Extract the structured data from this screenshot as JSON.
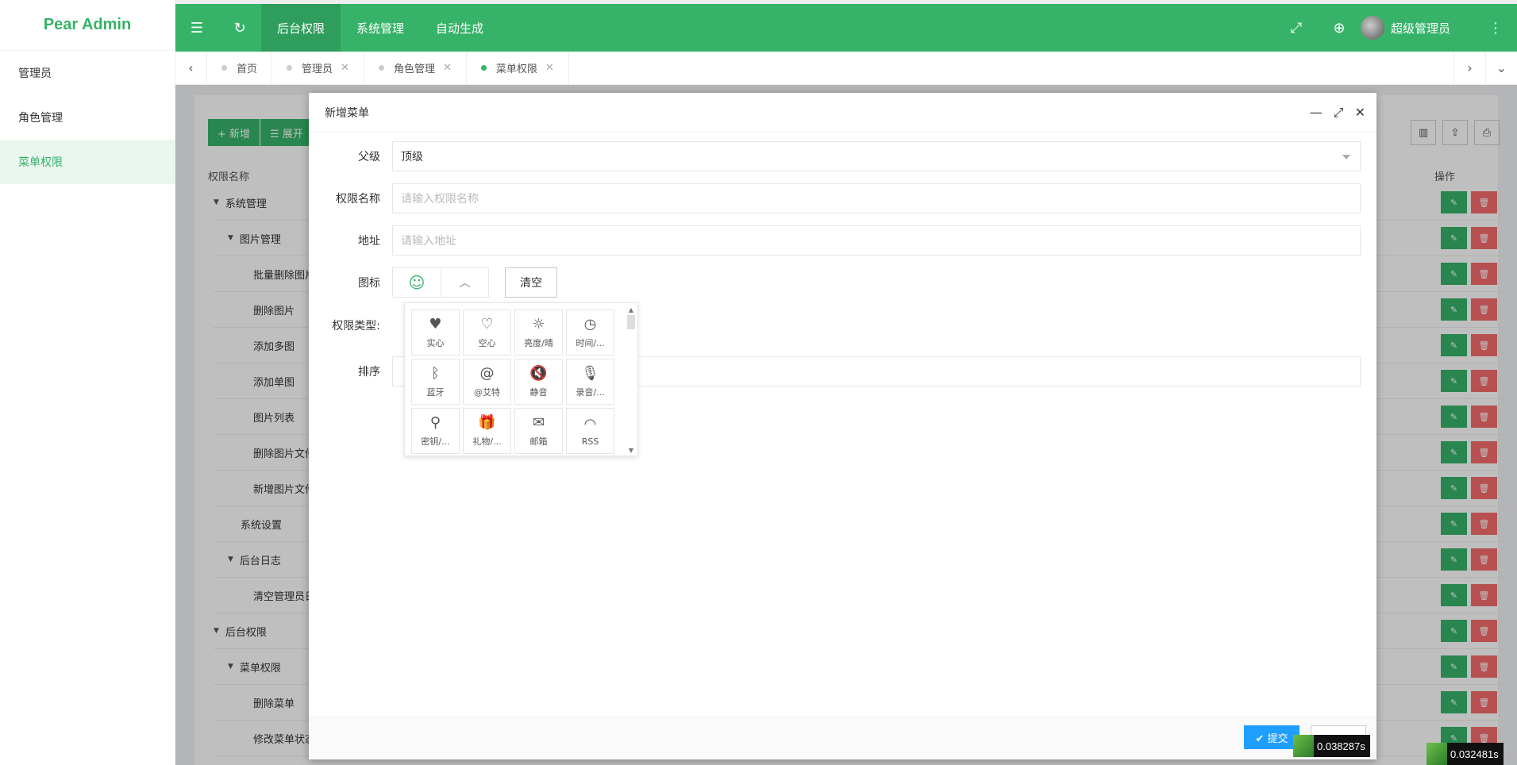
{
  "app": {
    "logo": "Pear Admin"
  },
  "sidebar": {
    "items": [
      {
        "label": "管理员",
        "active": false
      },
      {
        "label": "角色管理",
        "active": false
      },
      {
        "label": "菜单权限",
        "active": true
      }
    ]
  },
  "header": {
    "nav": [
      {
        "label": "后台权限",
        "active": true
      },
      {
        "label": "系统管理",
        "active": false
      },
      {
        "label": "自动生成",
        "active": false
      }
    ],
    "username": "超级管理员"
  },
  "tabs": [
    {
      "label": "首页",
      "closable": false,
      "active": false
    },
    {
      "label": "管理员",
      "closable": true,
      "active": false
    },
    {
      "label": "角色管理",
      "closable": true,
      "active": false
    },
    {
      "label": "菜单权限",
      "closable": true,
      "active": true
    }
  ],
  "toolbar": {
    "add": "+ 新增",
    "expand": "☰ 展开"
  },
  "table": {
    "col_name": "权限名称",
    "col_ops": "操作",
    "rows": [
      {
        "label": "系统管理",
        "level": 0,
        "caret": true
      },
      {
        "label": "图片管理",
        "level": 1,
        "caret": true
      },
      {
        "label": "批量删除图片",
        "level": 2,
        "caret": false
      },
      {
        "label": "删除图片",
        "level": 2,
        "caret": false
      },
      {
        "label": "添加多图",
        "level": 2,
        "caret": false
      },
      {
        "label": "添加单图",
        "level": 2,
        "caret": false
      },
      {
        "label": "图片列表",
        "level": 2,
        "caret": false
      },
      {
        "label": "删除图片文件夹",
        "level": 2,
        "caret": false
      },
      {
        "label": "新增图片文件夹",
        "level": 2,
        "caret": false
      },
      {
        "label": "系统设置",
        "level": 1,
        "caret": false
      },
      {
        "label": "后台日志",
        "level": 1,
        "caret": true
      },
      {
        "label": "清空管理员日志",
        "level": 2,
        "caret": false
      },
      {
        "label": "后台权限",
        "level": 0,
        "caret": true
      },
      {
        "label": "菜单权限",
        "level": 1,
        "caret": true
      },
      {
        "label": "删除菜单",
        "level": 2,
        "caret": false
      },
      {
        "label": "修改菜单状态",
        "level": 2,
        "caret": false
      }
    ]
  },
  "dialog": {
    "title": "新增菜单",
    "fields": {
      "parent_label": "父级",
      "parent_value": "顶级",
      "name_label": "权限名称",
      "name_placeholder": "请输入权限名称",
      "url_label": "地址",
      "url_placeholder": "请输入地址",
      "icon_label": "图标",
      "clear_label": "清空",
      "type_label": "权限类型:",
      "sort_label": "排序"
    },
    "icons": [
      {
        "glyph": "♥",
        "label": "实心"
      },
      {
        "glyph": "♡",
        "label": "空心"
      },
      {
        "glyph": "☼",
        "label": "亮度/晴"
      },
      {
        "glyph": "◷",
        "label": "时间/..."
      },
      {
        "glyph": "ᛒ",
        "label": "蓝牙"
      },
      {
        "glyph": "@",
        "label": "@艾特"
      },
      {
        "glyph": "🔇",
        "label": "静音"
      },
      {
        "glyph": "🎙",
        "label": "录音/..."
      },
      {
        "glyph": "⚲",
        "label": "密钥/..."
      },
      {
        "glyph": "🎁",
        "label": "礼物/..."
      },
      {
        "glyph": "✉",
        "label": "邮箱"
      },
      {
        "glyph": "◠",
        "label": "RSS"
      }
    ],
    "submit": "✔ 提交"
  },
  "timers": [
    "0.038287s",
    "0.032481s"
  ]
}
